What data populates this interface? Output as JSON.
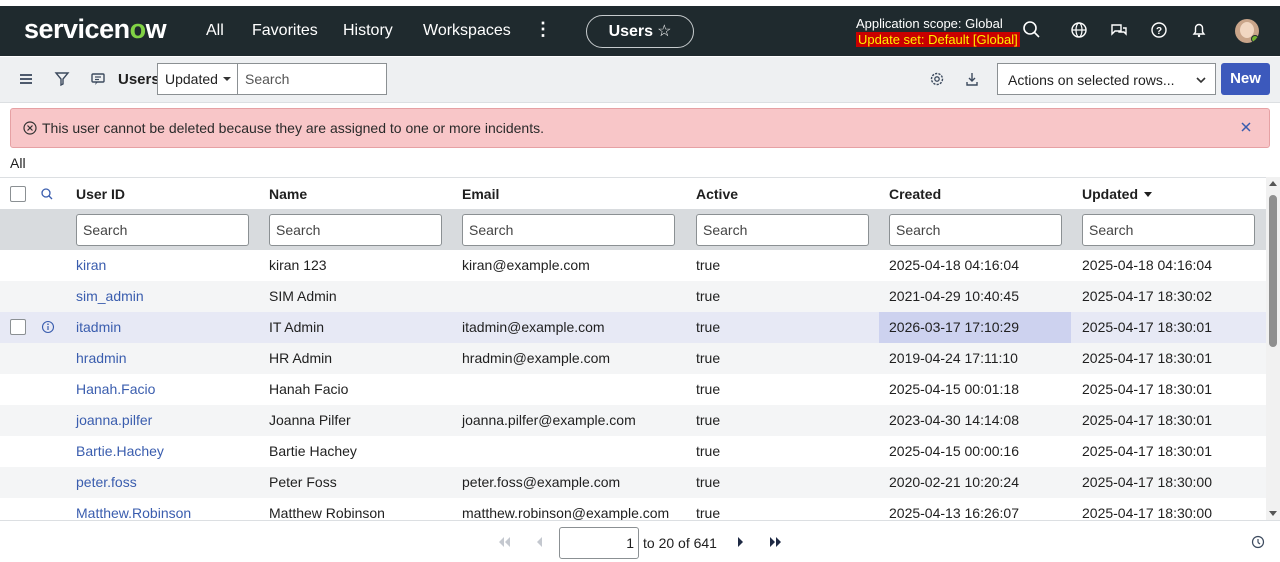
{
  "brand": {
    "logo_prefix": "servicen",
    "logo_o": "o",
    "logo_suffix": "w"
  },
  "nav": {
    "links": [
      "All",
      "Favorites",
      "History",
      "Workspaces"
    ],
    "users_pill": "Users",
    "scope": "Application scope: Global",
    "update_set": "Update set: Default [Global]"
  },
  "toolbar": {
    "title": "Users",
    "field_select": "Updated",
    "search_placeholder": "Search",
    "actions_placeholder": "Actions on selected rows...",
    "new_label": "New"
  },
  "banner": {
    "message": "This user cannot be deleted because they are assigned to one or more incidents."
  },
  "breadcrumb": "All",
  "table": {
    "columns": [
      "User ID",
      "Name",
      "Email",
      "Active",
      "Created",
      "Updated"
    ],
    "search_placeholder": "Search",
    "rows": [
      {
        "user_id": "kiran",
        "name": "kiran 123",
        "email": "kiran@example.com",
        "active": "true",
        "created": "2025-04-18 04:16:04",
        "updated": "2025-04-18 04:16:04"
      },
      {
        "user_id": "sim_admin",
        "name": "SIM Admin",
        "email": "",
        "active": "true",
        "created": "2021-04-29 10:40:45",
        "updated": "2025-04-17 18:30:02"
      },
      {
        "user_id": "itadmin",
        "name": "IT Admin",
        "email": "itadmin@example.com",
        "active": "true",
        "created": "2026-03-17 17:10:29",
        "updated": "2025-04-17 18:30:01"
      },
      {
        "user_id": "hradmin",
        "name": "HR Admin",
        "email": "hradmin@example.com",
        "active": "true",
        "created": "2019-04-24 17:11:10",
        "updated": "2025-04-17 18:30:01"
      },
      {
        "user_id": "Hanah.Facio",
        "name": "Hanah Facio",
        "email": "",
        "active": "true",
        "created": "2025-04-15 00:01:18",
        "updated": "2025-04-17 18:30:01"
      },
      {
        "user_id": "joanna.pilfer",
        "name": "Joanna Pilfer",
        "email": "joanna.pilfer@example.com",
        "active": "true",
        "created": "2023-04-30 14:14:08",
        "updated": "2025-04-17 18:30:01"
      },
      {
        "user_id": "Bartie.Hachey",
        "name": "Bartie Hachey",
        "email": "",
        "active": "true",
        "created": "2025-04-15 00:00:16",
        "updated": "2025-04-17 18:30:01"
      },
      {
        "user_id": "peter.foss",
        "name": "Peter Foss",
        "email": "peter.foss@example.com",
        "active": "true",
        "created": "2020-02-21 10:20:24",
        "updated": "2025-04-17 18:30:00"
      },
      {
        "user_id": "Matthew.Robinson",
        "name": "Matthew Robinson",
        "email": "matthew.robinson@example.com",
        "active": "true",
        "created": "2025-04-13 16:26:07",
        "updated": "2025-04-17 18:30:00"
      }
    ]
  },
  "pager": {
    "current": "1",
    "range_text": "to 20 of 641"
  },
  "colors": {
    "nav_bg": "#1f2a2e",
    "brand_green": "#81d245",
    "primary": "#3c59bc",
    "link": "#3a5dae",
    "error_bg": "#f8c6c8",
    "update_set_bg": "#c80000",
    "update_set_fg": "#ffee00"
  }
}
